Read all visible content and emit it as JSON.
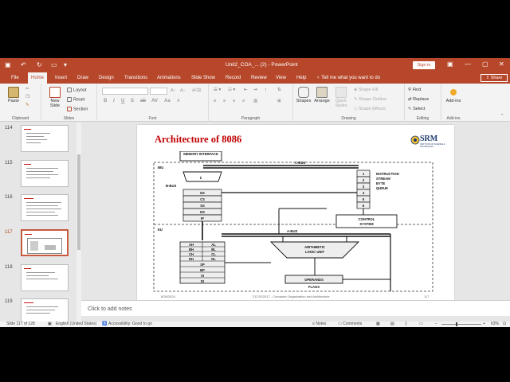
{
  "window": {
    "title": "Unit2_COA_... (2)  -  PowerPoint",
    "signin_label": "Sign in"
  },
  "menu": {
    "tabs": [
      "File",
      "Home",
      "Insert",
      "Draw",
      "Design",
      "Transitions",
      "Animations",
      "Slide Show",
      "Record",
      "Review",
      "View",
      "Help"
    ],
    "active_tab": "Home",
    "tell_me": "Tell me what you want to do",
    "share_label": "Share"
  },
  "ribbon": {
    "clipboard": {
      "label": "Clipboard",
      "paste": "Paste"
    },
    "slides": {
      "label": "Slides",
      "new_slide": "New Slide",
      "layout": "Layout",
      "reset": "Reset",
      "section": "Section"
    },
    "font": {
      "label": "Font",
      "bold": "B",
      "italic": "I",
      "underline": "U",
      "strike": "S",
      "shadow": "ab",
      "spacing": "AV",
      "case": "Aa"
    },
    "paragraph": {
      "label": "Paragraph"
    },
    "drawing": {
      "label": "Drawing",
      "shapes": "Shapes",
      "arrange": "Arrange",
      "quick_styles": "Quick Styles",
      "shape_fill": "Shape Fill",
      "shape_outline": "Shape Outline",
      "shape_effects": "Shape Effects"
    },
    "editing": {
      "label": "Editing",
      "find": "Find",
      "replace": "Replace",
      "select": "Select"
    },
    "addins": {
      "label": "Add-ins",
      "addins": "Add-ins"
    }
  },
  "thumbnails": [
    {
      "num": "114",
      "title": ""
    },
    {
      "num": "115",
      "title": ""
    },
    {
      "num": "116",
      "title": ""
    },
    {
      "num": "117",
      "title": ""
    },
    {
      "num": "118",
      "title": ""
    },
    {
      "num": "119",
      "title": ""
    }
  ],
  "selected_slide": "117",
  "slide": {
    "title": "Architecture of 8086",
    "logo_text": "SRM",
    "logo_subtext": "INSTITUTE OF SCIENCE & TECHNOLOGY",
    "footer_date": "8/26/2024",
    "footer_center": "21CSS201T - Computer Organization and Architecture",
    "footer_page": "117",
    "diagram": {
      "memory_interface": "MEMORY INTERFACE",
      "biu": "BIU",
      "eu": "EU",
      "c_bus": "C-BUS",
      "b_bus": "B-BUS",
      "a_bus": "A-BUS",
      "sigma": "Σ",
      "segment_regs": [
        "ES",
        "CS",
        "SS",
        "DS",
        "IP"
      ],
      "queue_labels": [
        "INSTRUCTION",
        "STREAM",
        "BYTE",
        "QUEUE"
      ],
      "queue_cells": [
        "1",
        "2",
        "3",
        "4",
        "5",
        "6"
      ],
      "control_system": [
        "CONTROL",
        "SYSTEM"
      ],
      "general_regs": [
        [
          "AH",
          "AL"
        ],
        [
          "BH",
          "BL"
        ],
        [
          "CH",
          "CL"
        ],
        [
          "DH",
          "DL"
        ]
      ],
      "pointer_regs": [
        "SP",
        "BP",
        "SI",
        "DI"
      ],
      "alu": [
        "ARITHMETIC",
        "LOGIC UNIT"
      ],
      "operands": "OPERANDS",
      "flags": "FLAGS"
    }
  },
  "notes_placeholder": "Click to add notes",
  "status": {
    "slide_info": "Slide 117 of 128",
    "language": "English (United States)",
    "accessibility": "Accessibility: Good to go",
    "notes": "Notes",
    "comments": "Comments",
    "zoom": "63%"
  },
  "colors": {
    "accent": "#b7472a",
    "slide_title": "#c00000"
  }
}
